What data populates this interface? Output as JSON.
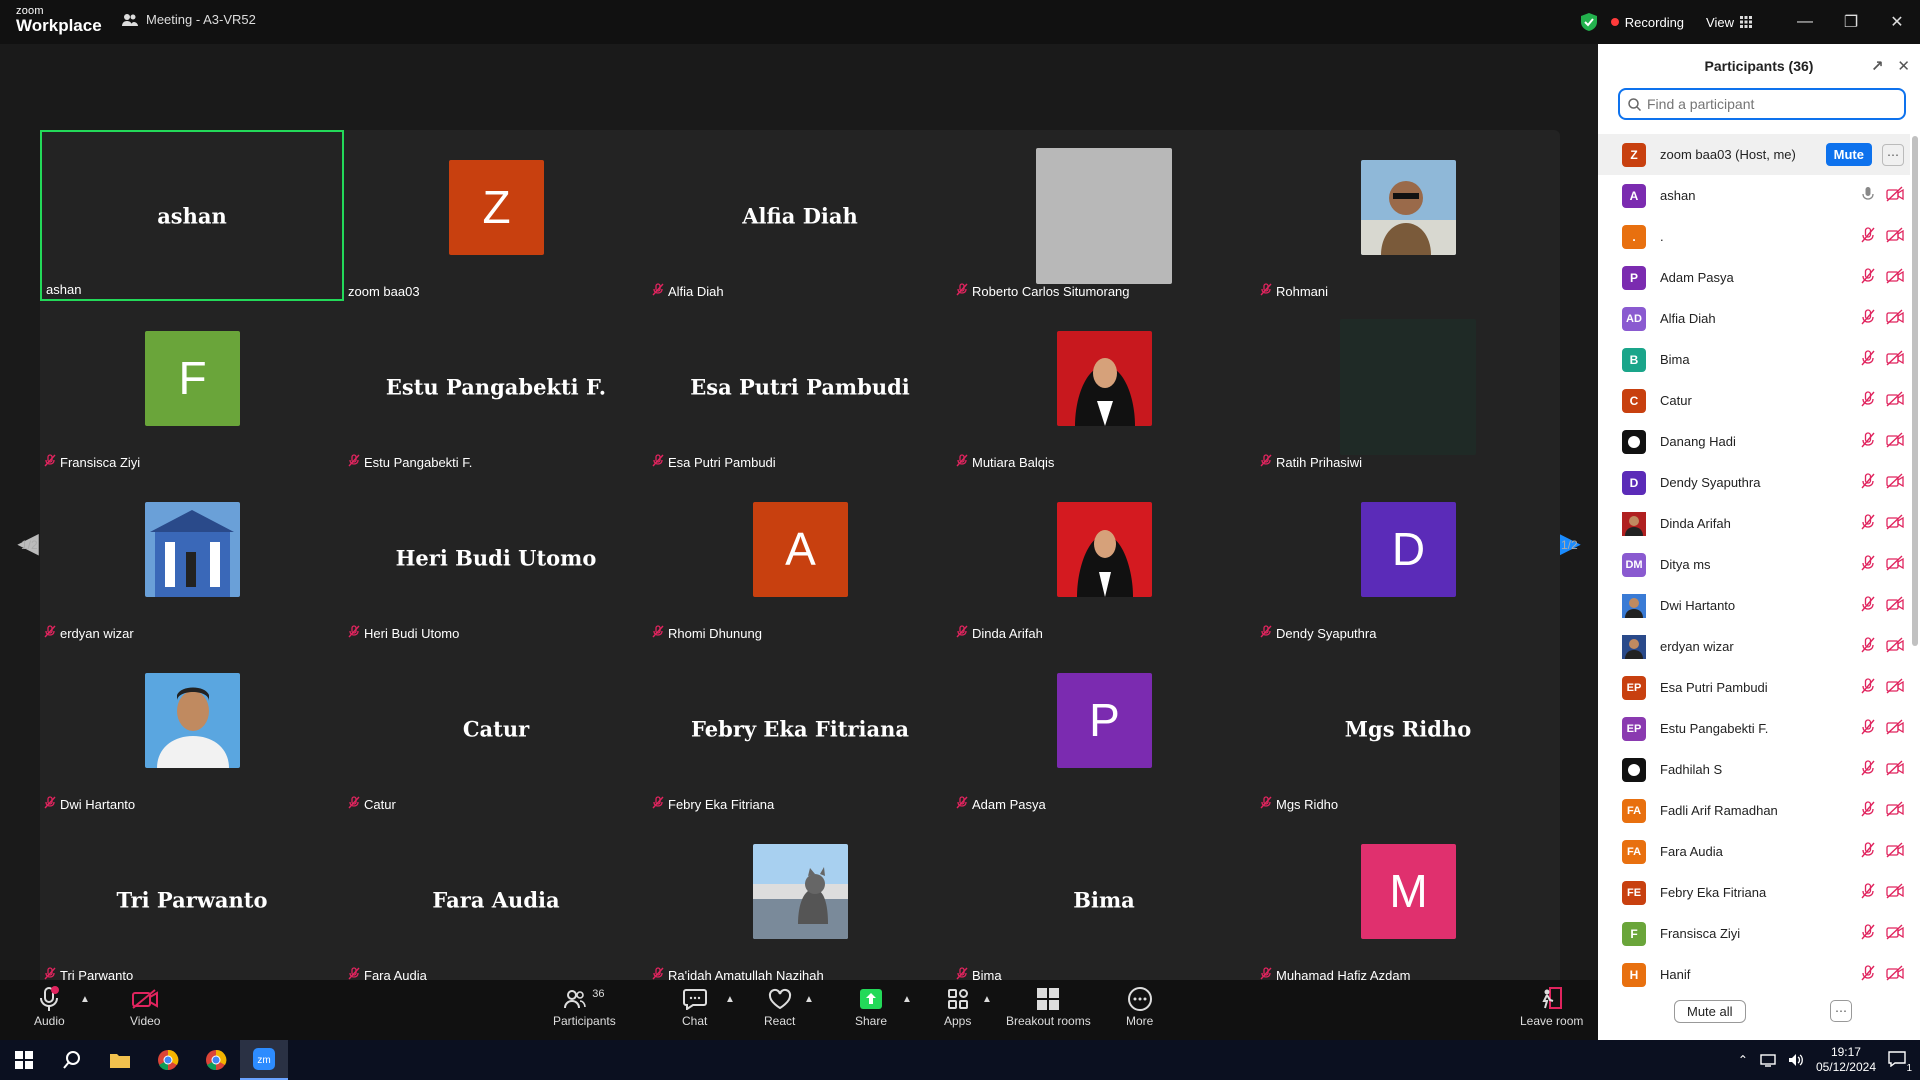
{
  "app": {
    "logo_line1": "zoom",
    "logo_line2": "Workplace",
    "meeting_title": "Meeting - A3-VR52"
  },
  "titlebar": {
    "recording_label": "Recording",
    "view_label": "View"
  },
  "gallery": {
    "page_left": "1/2",
    "page_right": "1/2",
    "tiles": [
      {
        "label": "ashan",
        "big": "ashan",
        "kind": "name",
        "active": true,
        "muted": false
      },
      {
        "label": "zoom baa03",
        "kind": "avatar",
        "letter": "Z",
        "color": "#c8400f",
        "muted": false
      },
      {
        "label": "Alfia Diah",
        "big": "Alfia Diah",
        "kind": "name",
        "muted": true
      },
      {
        "label": "Roberto Carlos Situmorang",
        "kind": "grey",
        "muted": true
      },
      {
        "label": "Rohmani",
        "kind": "photo",
        "photo": "man-selfie",
        "muted": true
      },
      {
        "label": "Fransisca Ziyi",
        "kind": "avatar",
        "letter": "F",
        "color": "#6aa53a",
        "muted": true
      },
      {
        "label": "Estu Pangabekti F.",
        "big": "Estu Pangabekti F.",
        "kind": "name",
        "muted": true
      },
      {
        "label": "Esa Putri Pambudi",
        "big": "Esa Putri Pambudi",
        "kind": "name",
        "muted": true
      },
      {
        "label": "Mutiara Balqis",
        "kind": "photo",
        "photo": "woman-red",
        "muted": true
      },
      {
        "label": "Ratih Prihasiwi",
        "kind": "dark",
        "muted": true
      },
      {
        "label": "erdyan wizar",
        "kind": "photo",
        "photo": "building",
        "muted": true
      },
      {
        "label": "Heri Budi Utomo",
        "big": "Heri Budi Utomo",
        "kind": "name",
        "muted": true
      },
      {
        "label": "Rhomi Dhunung",
        "kind": "avatar",
        "letter": "A",
        "color": "#c8400f",
        "muted": true
      },
      {
        "label": "Dinda Arifah",
        "kind": "photo",
        "photo": "woman-red2",
        "muted": true
      },
      {
        "label": "Dendy Syaputhra",
        "kind": "avatar",
        "letter": "D",
        "color": "#5b2bb8",
        "muted": true
      },
      {
        "label": "Dwi Hartanto",
        "kind": "photo",
        "photo": "man-blue",
        "muted": true
      },
      {
        "label": "Catur",
        "big": "Catur",
        "kind": "name",
        "muted": true
      },
      {
        "label": "Febry Eka Fitriana",
        "big": "Febry Eka Fitriana",
        "kind": "name",
        "muted": true
      },
      {
        "label": "Adam Pasya",
        "kind": "avatar",
        "letter": "P",
        "color": "#7b2bb0",
        "muted": true
      },
      {
        "label": "Mgs Ridho",
        "big": "Mgs Ridho",
        "kind": "name",
        "muted": true
      },
      {
        "label": "Tri Parwanto",
        "big": "Tri Parwanto",
        "kind": "name",
        "muted": true
      },
      {
        "label": "Fara Audia",
        "big": "Fara Audia",
        "kind": "name",
        "muted": true
      },
      {
        "label": "Ra'idah Amatullah Nazihah",
        "kind": "photo",
        "photo": "cat",
        "muted": true
      },
      {
        "label": "Bima",
        "big": "Bima",
        "kind": "name",
        "muted": true
      },
      {
        "label": "Muhamad Hafiz Azdam",
        "kind": "avatar",
        "letter": "M",
        "color": "#e0306e",
        "muted": true
      }
    ]
  },
  "toolbar": {
    "audio": "Audio",
    "video": "Video",
    "participants": "Participants",
    "participants_count": "36",
    "chat": "Chat",
    "react": "React",
    "share": "Share",
    "apps": "Apps",
    "breakout": "Breakout rooms",
    "more": "More",
    "leave": "Leave room"
  },
  "panel": {
    "title": "Participants (36)",
    "search_placeholder": "Find a participant",
    "mute_label": "Mute",
    "mute_all": "Mute all",
    "participants": [
      {
        "name": "zoom baa03 (Host, me)",
        "initials": "Z",
        "color": "#c8400f",
        "me": true
      },
      {
        "name": "ashan",
        "initials": "A",
        "color": "#7b2bb0",
        "mic": "on"
      },
      {
        "name": ".",
        "initials": ".",
        "color": "#e8700f"
      },
      {
        "name": "Adam Pasya",
        "initials": "P",
        "color": "#7b2bb0"
      },
      {
        "name": "Alfia Diah",
        "initials": "AD",
        "color": "#8a5ad0"
      },
      {
        "name": "Bima",
        "initials": "B",
        "color": "#1aa58a"
      },
      {
        "name": "Catur",
        "initials": "C",
        "color": "#c8400f"
      },
      {
        "name": "Danang Hadi",
        "initials": "",
        "color": "#111111"
      },
      {
        "name": "Dendy Syaputhra",
        "initials": "D",
        "color": "#5b2bb8"
      },
      {
        "name": "Dinda Arifah",
        "initials": "",
        "color": "#b02020",
        "photo": true
      },
      {
        "name": "Ditya ms",
        "initials": "DM",
        "color": "#8a5ad0"
      },
      {
        "name": "Dwi Hartanto",
        "initials": "",
        "color": "#3a7bd5",
        "photo": true
      },
      {
        "name": "erdyan wizar",
        "initials": "",
        "color": "#2a4a8a",
        "photo": true
      },
      {
        "name": "Esa Putri Pambudi",
        "initials": "EP",
        "color": "#c8400f"
      },
      {
        "name": "Estu Pangabekti F.",
        "initials": "EP",
        "color": "#8a3ab0"
      },
      {
        "name": "Fadhilah S",
        "initials": "",
        "color": "#111111"
      },
      {
        "name": "Fadli Arif Ramadhan",
        "initials": "FA",
        "color": "#e8700f"
      },
      {
        "name": "Fara Audia",
        "initials": "FA",
        "color": "#e8700f"
      },
      {
        "name": "Febry Eka Fitriana",
        "initials": "FE",
        "color": "#c8400f"
      },
      {
        "name": "Fransisca Ziyi",
        "initials": "F",
        "color": "#6aa53a"
      },
      {
        "name": "Hanif",
        "initials": "H",
        "color": "#e8700f"
      }
    ]
  },
  "taskbar": {
    "time": "19:17",
    "date": "05/12/2024",
    "notif_count": "1"
  }
}
